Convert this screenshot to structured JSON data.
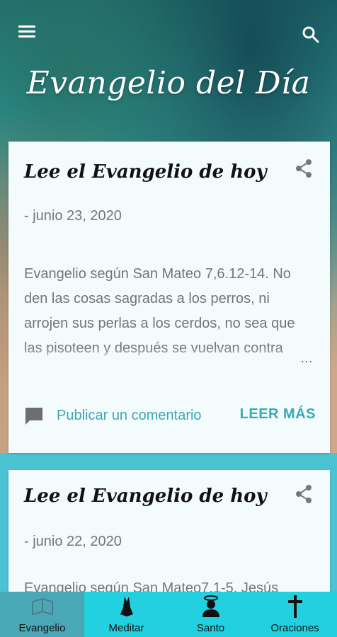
{
  "app": {
    "title": "Evangelio del Día"
  },
  "posts": [
    {
      "title": "Lee el Evangelio de hoy",
      "date": "- junio 23, 2020",
      "excerpt": "Evangelio según San Mateo 7,6.12-14. No den las cosas sagradas a los perros, ni arrojen sus perlas a los cerdos, no sea que las pisoteen y después se vuelvan contra ustedes para destrozarlos. To",
      "ellipsis": "…",
      "comment_label": "Publicar un comentario",
      "read_more_label": "LEER MÁS"
    },
    {
      "title": "Lee el Evangelio de hoy",
      "date": "- junio 22, 2020",
      "excerpt": "Evangelio según San Mateo7,1-5. Jesús"
    }
  ],
  "bottom_nav": [
    {
      "label": "Evangelio",
      "icon": "book-icon",
      "active": true
    },
    {
      "label": "Meditar",
      "icon": "praying-hands-icon",
      "active": false
    },
    {
      "label": "Santo",
      "icon": "saint-icon",
      "active": false
    },
    {
      "label": "Oraciones",
      "icon": "cross-icon",
      "active": false
    }
  ],
  "colors": {
    "accent": "#3aa8b6",
    "nav_background": "#22d0e0",
    "nav_active": "#4aa8b6",
    "card_background": "#f4fbfc",
    "muted_text": "#757575"
  }
}
